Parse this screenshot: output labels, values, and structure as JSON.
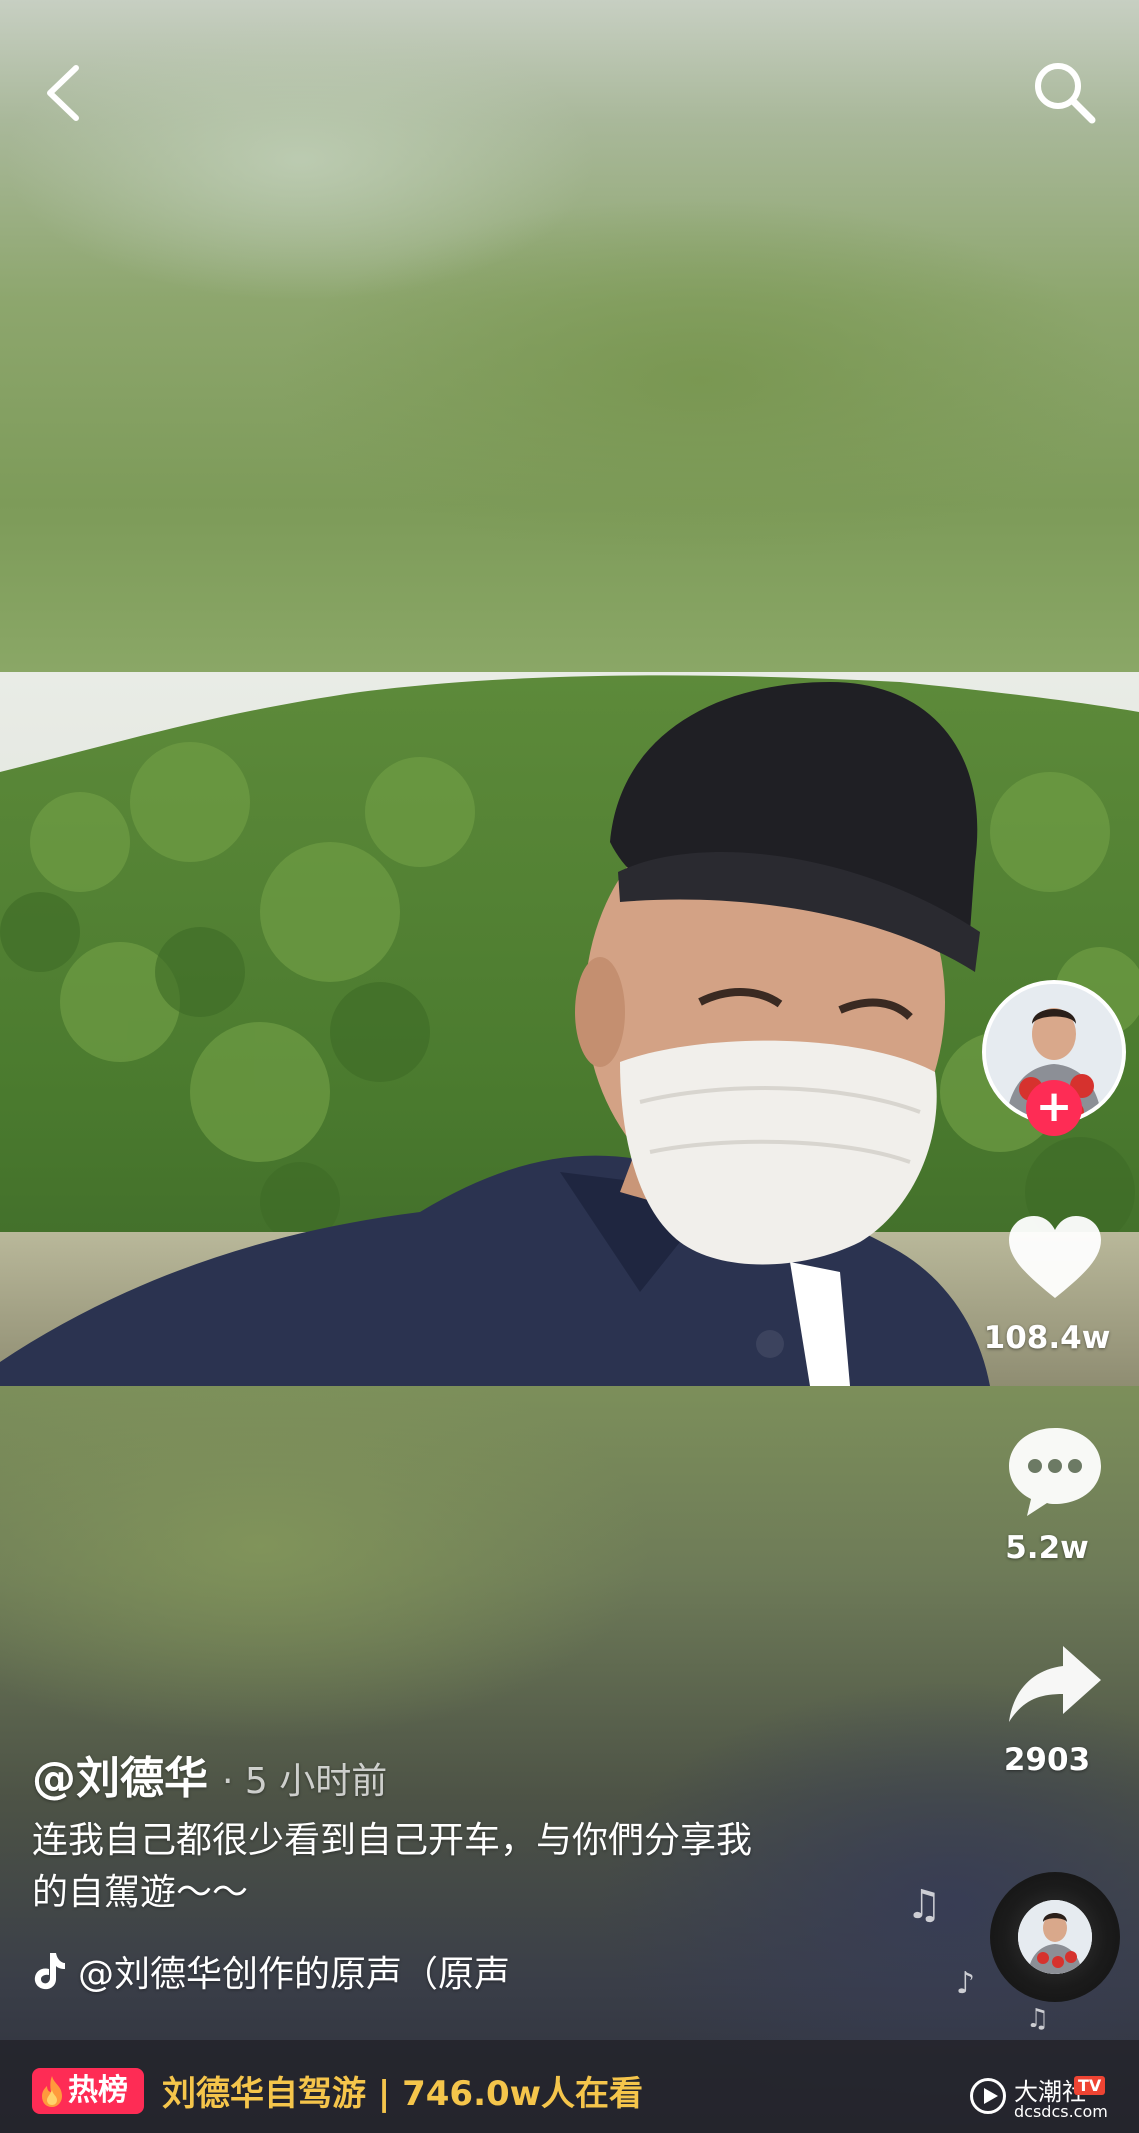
{
  "top_bar": {
    "back_icon": "chevron-left-icon",
    "search_icon": "search-icon"
  },
  "video": {
    "description_visible": "selfie video of a man in a black cap, white face mask and navy jacket in front of a forested hillside"
  },
  "side_rail": {
    "avatar_icon": "avatar",
    "follow_icon": "plus-icon",
    "like_icon": "heart-icon",
    "like_count": "108.4w",
    "comment_icon": "comment-bubble-icon",
    "comment_count": "5.2w",
    "share_icon": "share-arrow-icon",
    "share_count": "2903"
  },
  "post": {
    "author": "@刘德华",
    "time": "· 5 小时前",
    "caption_line1": "连我自己都很少看到自己开车，与你們分享我",
    "caption_line2": "的自駕遊～～",
    "music": "@刘德华创作的原声（原声",
    "music_icon": "tiktok-note-icon"
  },
  "hot_bar": {
    "badge": "热榜",
    "text": "刘德华自驾游 | 746.0w人在看"
  },
  "watermark": {
    "title": "大潮社",
    "tv": "TV",
    "url": "dcsdcs.com"
  },
  "colors": {
    "accent_red": "#fe2c55",
    "hot_text": "#f5c54b"
  }
}
